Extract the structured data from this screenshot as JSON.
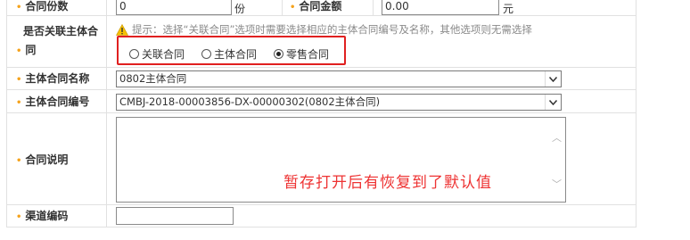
{
  "form": {
    "row_contract_count": {
      "label": "合同份数",
      "value": "0",
      "unit": "份"
    },
    "row_contract_amount": {
      "label": "合同金额",
      "value": "0.00",
      "unit": "元"
    },
    "row_related": {
      "label_line1": "是否关联主体合",
      "label_line2": "同",
      "hint": "提示：选择“关联合同”选项时需要选择相应的主体合同编号及名称，其他选项则无需选择",
      "options": [
        "关联合同",
        "主体合同",
        "零售合同"
      ],
      "selected": "零售合同"
    },
    "row_main_name": {
      "label": "主体合同名称",
      "value": "0802主体合同"
    },
    "row_main_no": {
      "label": "主体合同编号",
      "value": "CMBJ-2018-00003856-DX-00000302(0802主体合同)"
    },
    "row_desc": {
      "label": "合同说明",
      "value": ""
    },
    "row_channel": {
      "label": "渠道编码",
      "value": ""
    }
  },
  "annotation": "暂存打开后有恢复到了默认值",
  "colors": {
    "bullet": "#f5a21b",
    "highlight_border": "#e02020",
    "annotation": "#e33333"
  }
}
